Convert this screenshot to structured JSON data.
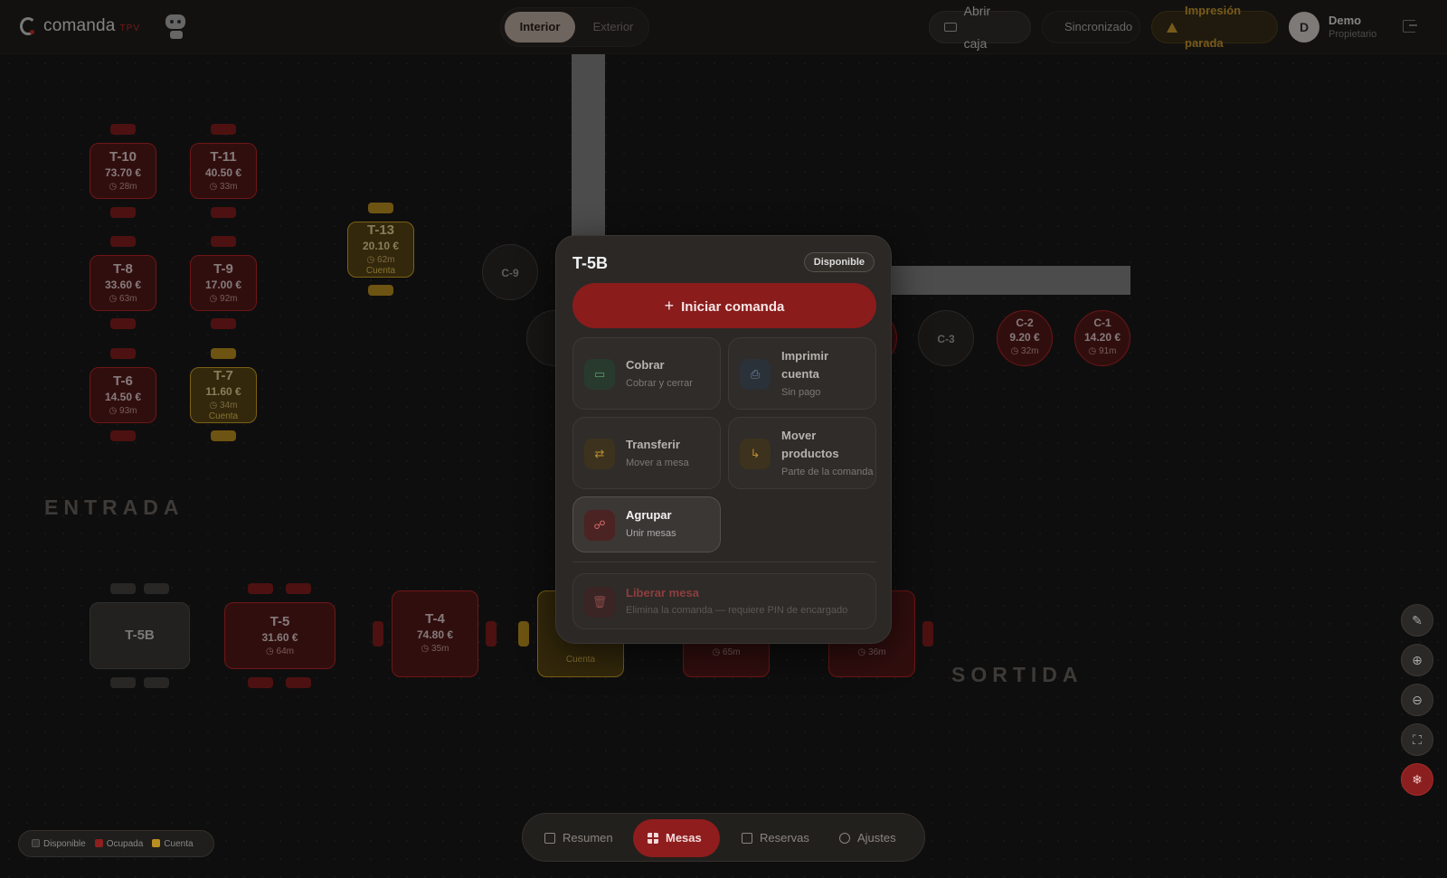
{
  "header": {
    "brand": "comanda",
    "brand_suffix": "TPV",
    "zones": [
      "Interior",
      "Exterior"
    ],
    "open_register": "Abrir caja",
    "sync_status": "Sincronizado",
    "print_status": "Impresión parada",
    "user_initial": "D",
    "user_name": "Demo",
    "user_role": "Propietario"
  },
  "floor": {
    "labels": {
      "entrada": "ENTRADA",
      "sortida": "SORTIDA"
    },
    "tables": [
      {
        "name": "T-10",
        "amount": "73.70 €",
        "time": "◷ 28m"
      },
      {
        "name": "T-11",
        "amount": "40.50 €",
        "time": "◷ 33m"
      },
      {
        "name": "T-8",
        "amount": "33.60 €",
        "time": "◷ 63m"
      },
      {
        "name": "T-9",
        "amount": "17.00 €",
        "time": "◷ 92m"
      },
      {
        "name": "T-6",
        "amount": "14.50 €",
        "time": "◷ 93m"
      },
      {
        "name": "T-7",
        "amount": "11.60 €",
        "time": "◷ 34m",
        "note": "Cuenta"
      },
      {
        "name": "T-13",
        "amount": "20.10 €",
        "time": "◷ 62m",
        "note": "Cuenta"
      },
      {
        "name": "T-5B"
      },
      {
        "name": "T-5",
        "amount": "31.60 €",
        "time": "◷ 64m"
      },
      {
        "name": "T-4",
        "amount": "74.80 €",
        "time": "◷ 35m"
      },
      {
        "name": "C-9"
      },
      {
        "name": "C-3"
      },
      {
        "name": "C-2",
        "amount": "9.20 €",
        "time": "◷ 32m"
      },
      {
        "name": "C-1",
        "amount": "14.20 €",
        "time": "◷ 91m"
      }
    ],
    "partial": {
      "cuenta_note": "Cuenta",
      "time_a": "◷ 65m",
      "time_b": "◷ 36m"
    }
  },
  "modal": {
    "table": "T-5B",
    "status": "Disponible",
    "primary": "Iniciar comanda",
    "actions": [
      {
        "title": "Cobrar",
        "subtitle": "Cobrar y cerrar",
        "icon": "card-icon"
      },
      {
        "title": "Imprimir cuenta",
        "subtitle": "Sin pago",
        "icon": "printer-icon"
      },
      {
        "title": "Transferir",
        "subtitle": "Mover a mesa",
        "icon": "transfer-icon"
      },
      {
        "title": "Mover productos",
        "subtitle": "Parte de la comanda",
        "icon": "move-icon"
      },
      {
        "title": "Agrupar",
        "subtitle": "Unir mesas",
        "icon": "group-icon"
      }
    ],
    "danger": {
      "title": "Liberar mesa",
      "subtitle": "Elimina la comanda — requiere PIN de encargado",
      "icon": "trash-icon"
    }
  },
  "legend": [
    "Disponible",
    "Ocupada",
    "Cuenta"
  ],
  "nav": [
    "Resumen",
    "Mesas",
    "Reservas",
    "Ajustes"
  ],
  "colors": {
    "accent": "#8f1d1d",
    "occupied": "#c62828",
    "bill": "#e2b028",
    "synced": "#3fa55d",
    "warning": "#d9a530"
  }
}
